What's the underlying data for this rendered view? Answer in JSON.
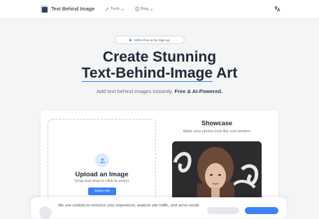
{
  "nav": {
    "brand": "Text Behind Image",
    "items": [
      {
        "label": "Tools",
        "icon": "wand-icon"
      },
      {
        "label": "Blog",
        "icon": "book-icon"
      }
    ],
    "language_icon": "translate-icon"
  },
  "hero": {
    "badge": "100% Free & No Sign-up",
    "title_line1": "Create Stunning",
    "title_highlight": "Text-Behind-Image",
    "title_rest": " Art",
    "subtitle_plain": "Add text behind images instantly. ",
    "subtitle_bold": "Free & AI-Powered."
  },
  "upload": {
    "title": "Upload an Image",
    "hint": "Drag and drop or click to select",
    "button": "Select File"
  },
  "showcase": {
    "title": "Showcase",
    "subtitle": "Make your photos look like cool posters"
  },
  "cookie": {
    "text": "We use cookies to enhance your experience, analyze site traffic, and serve social"
  },
  "colors": {
    "accent": "#3b82f6",
    "background": "#f4f5f7",
    "card": "#ffffff"
  }
}
